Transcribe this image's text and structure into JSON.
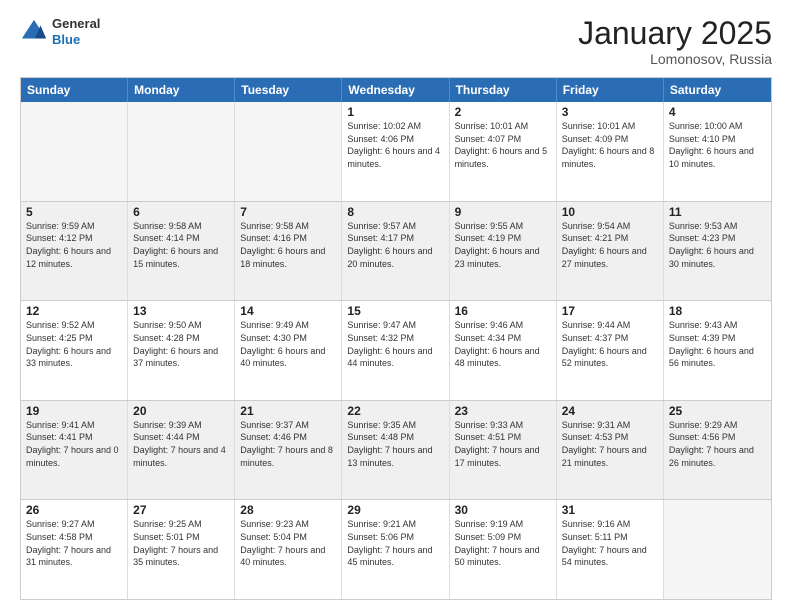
{
  "header": {
    "logo": {
      "general": "General",
      "blue": "Blue"
    },
    "title": "January 2025",
    "location": "Lomonosov, Russia"
  },
  "day_headers": [
    "Sunday",
    "Monday",
    "Tuesday",
    "Wednesday",
    "Thursday",
    "Friday",
    "Saturday"
  ],
  "weeks": [
    [
      {
        "day": "",
        "info": "",
        "empty": true
      },
      {
        "day": "",
        "info": "",
        "empty": true
      },
      {
        "day": "",
        "info": "",
        "empty": true
      },
      {
        "day": "1",
        "info": "Sunrise: 10:02 AM\nSunset: 4:06 PM\nDaylight: 6 hours\nand 4 minutes."
      },
      {
        "day": "2",
        "info": "Sunrise: 10:01 AM\nSunset: 4:07 PM\nDaylight: 6 hours\nand 5 minutes."
      },
      {
        "day": "3",
        "info": "Sunrise: 10:01 AM\nSunset: 4:09 PM\nDaylight: 6 hours\nand 8 minutes."
      },
      {
        "day": "4",
        "info": "Sunrise: 10:00 AM\nSunset: 4:10 PM\nDaylight: 6 hours\nand 10 minutes."
      }
    ],
    [
      {
        "day": "5",
        "info": "Sunrise: 9:59 AM\nSunset: 4:12 PM\nDaylight: 6 hours\nand 12 minutes."
      },
      {
        "day": "6",
        "info": "Sunrise: 9:58 AM\nSunset: 4:14 PM\nDaylight: 6 hours\nand 15 minutes."
      },
      {
        "day": "7",
        "info": "Sunrise: 9:58 AM\nSunset: 4:16 PM\nDaylight: 6 hours\nand 18 minutes."
      },
      {
        "day": "8",
        "info": "Sunrise: 9:57 AM\nSunset: 4:17 PM\nDaylight: 6 hours\nand 20 minutes."
      },
      {
        "day": "9",
        "info": "Sunrise: 9:55 AM\nSunset: 4:19 PM\nDaylight: 6 hours\nand 23 minutes."
      },
      {
        "day": "10",
        "info": "Sunrise: 9:54 AM\nSunset: 4:21 PM\nDaylight: 6 hours\nand 27 minutes."
      },
      {
        "day": "11",
        "info": "Sunrise: 9:53 AM\nSunset: 4:23 PM\nDaylight: 6 hours\nand 30 minutes."
      }
    ],
    [
      {
        "day": "12",
        "info": "Sunrise: 9:52 AM\nSunset: 4:25 PM\nDaylight: 6 hours\nand 33 minutes."
      },
      {
        "day": "13",
        "info": "Sunrise: 9:50 AM\nSunset: 4:28 PM\nDaylight: 6 hours\nand 37 minutes."
      },
      {
        "day": "14",
        "info": "Sunrise: 9:49 AM\nSunset: 4:30 PM\nDaylight: 6 hours\nand 40 minutes."
      },
      {
        "day": "15",
        "info": "Sunrise: 9:47 AM\nSunset: 4:32 PM\nDaylight: 6 hours\nand 44 minutes."
      },
      {
        "day": "16",
        "info": "Sunrise: 9:46 AM\nSunset: 4:34 PM\nDaylight: 6 hours\nand 48 minutes."
      },
      {
        "day": "17",
        "info": "Sunrise: 9:44 AM\nSunset: 4:37 PM\nDaylight: 6 hours\nand 52 minutes."
      },
      {
        "day": "18",
        "info": "Sunrise: 9:43 AM\nSunset: 4:39 PM\nDaylight: 6 hours\nand 56 minutes."
      }
    ],
    [
      {
        "day": "19",
        "info": "Sunrise: 9:41 AM\nSunset: 4:41 PM\nDaylight: 7 hours\nand 0 minutes."
      },
      {
        "day": "20",
        "info": "Sunrise: 9:39 AM\nSunset: 4:44 PM\nDaylight: 7 hours\nand 4 minutes."
      },
      {
        "day": "21",
        "info": "Sunrise: 9:37 AM\nSunset: 4:46 PM\nDaylight: 7 hours\nand 8 minutes."
      },
      {
        "day": "22",
        "info": "Sunrise: 9:35 AM\nSunset: 4:48 PM\nDaylight: 7 hours\nand 13 minutes."
      },
      {
        "day": "23",
        "info": "Sunrise: 9:33 AM\nSunset: 4:51 PM\nDaylight: 7 hours\nand 17 minutes."
      },
      {
        "day": "24",
        "info": "Sunrise: 9:31 AM\nSunset: 4:53 PM\nDaylight: 7 hours\nand 21 minutes."
      },
      {
        "day": "25",
        "info": "Sunrise: 9:29 AM\nSunset: 4:56 PM\nDaylight: 7 hours\nand 26 minutes."
      }
    ],
    [
      {
        "day": "26",
        "info": "Sunrise: 9:27 AM\nSunset: 4:58 PM\nDaylight: 7 hours\nand 31 minutes."
      },
      {
        "day": "27",
        "info": "Sunrise: 9:25 AM\nSunset: 5:01 PM\nDaylight: 7 hours\nand 35 minutes."
      },
      {
        "day": "28",
        "info": "Sunrise: 9:23 AM\nSunset: 5:04 PM\nDaylight: 7 hours\nand 40 minutes."
      },
      {
        "day": "29",
        "info": "Sunrise: 9:21 AM\nSunset: 5:06 PM\nDaylight: 7 hours\nand 45 minutes."
      },
      {
        "day": "30",
        "info": "Sunrise: 9:19 AM\nSunset: 5:09 PM\nDaylight: 7 hours\nand 50 minutes."
      },
      {
        "day": "31",
        "info": "Sunrise: 9:16 AM\nSunset: 5:11 PM\nDaylight: 7 hours\nand 54 minutes."
      },
      {
        "day": "",
        "info": "",
        "empty": true
      }
    ]
  ]
}
